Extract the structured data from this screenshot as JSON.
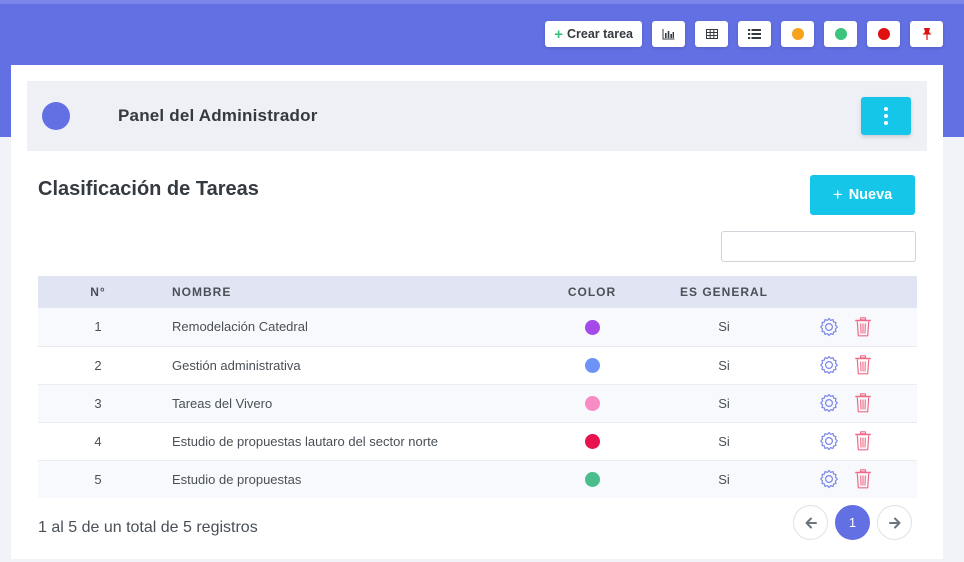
{
  "topbar": {
    "create_task_label": "Crear tarea",
    "dot_colors": [
      "#f7a21b",
      "#3ac47d",
      "#e01010"
    ]
  },
  "header": {
    "title": "Panel del Administrador",
    "avatar_color": "#6370e3"
  },
  "section": {
    "title": "Clasificación de Tareas",
    "new_button": "Nueva",
    "search_placeholder": ""
  },
  "table": {
    "headers": {
      "num": "N°",
      "name": "NOMBRE",
      "color": "COLOR",
      "general": "ES GENERAL"
    },
    "rows": [
      {
        "num": "1",
        "name": "Remodelación Catedral",
        "color": "#a44ae8",
        "general": "Si"
      },
      {
        "num": "2",
        "name": "Gestión administrativa",
        "color": "#6d94f5",
        "general": "Si"
      },
      {
        "num": "3",
        "name": "Tareas del Vivero",
        "color": "#f78bc4",
        "general": "Si"
      },
      {
        "num": "4",
        "name": "Estudio de propuestas lautaro del sector norte",
        "color": "#e8124e",
        "general": "Si"
      },
      {
        "num": "5",
        "name": "Estudio de propuestas",
        "color": "#49be8c",
        "general": "Si"
      }
    ]
  },
  "footer": {
    "summary": "1 al 5 de un total de 5 registros",
    "current_page": "1"
  },
  "icons": {
    "gear": "gear-icon",
    "trash": "trash-icon"
  }
}
